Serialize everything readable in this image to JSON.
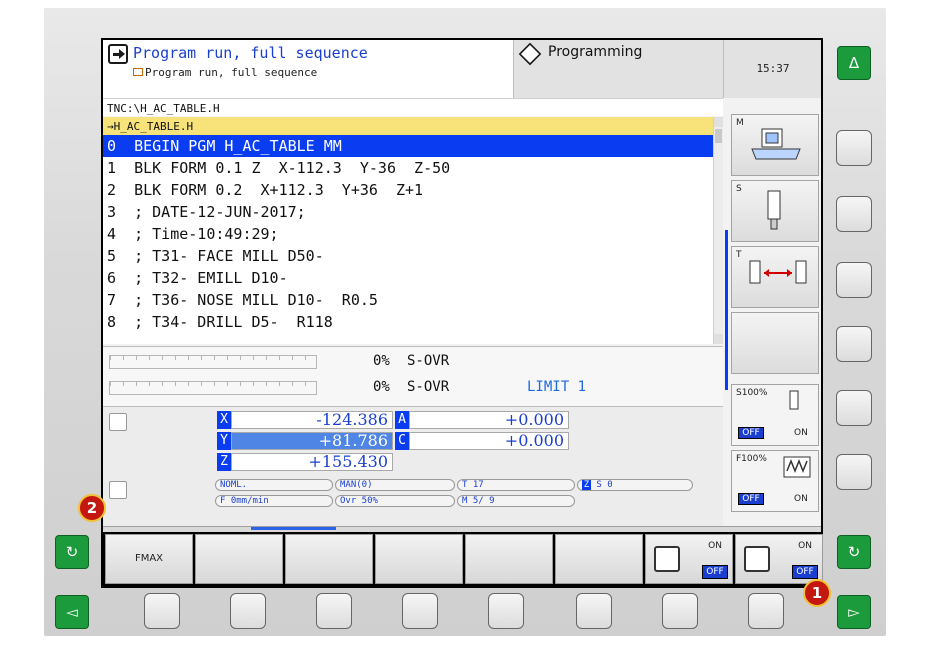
{
  "header": {
    "mode_title": "Program run, full sequence",
    "mode_subtitle": "Program run, full sequence",
    "secondary_mode": "Programming",
    "clock": "15:37"
  },
  "program": {
    "path": "TNC:\\H_AC_TABLE.H",
    "file": "→H_AC_TABLE.H",
    "lines": [
      "0  BEGIN PGM H_AC_TABLE MM",
      "1  BLK FORM 0.1 Z  X-112.3  Y-36  Z-50",
      "2  BLK FORM 0.2  X+112.3  Y+36  Z+1",
      "3  ; DATE-12-JUN-2017;",
      "4  ; Time-10:49:29;",
      "5  ; T31- FACE MILL D50-",
      "6  ; T32- EMILL D10-",
      "7  ; T36- NOSE MILL D10-  R0.5",
      "8  ; T34- DRILL D5-  R118"
    ]
  },
  "override": {
    "feed_pct": "0%",
    "feed_label": "S-OVR",
    "spindle_pct": "0%",
    "spindle_label": "S-OVR",
    "limit": "LIMIT 1"
  },
  "positions": {
    "x_label": "X",
    "x_value": "-124.386",
    "y_label": "Y",
    "y_value": "+81.786",
    "z_label": "Z",
    "z_value": "+155.430",
    "a_label": "A",
    "a_value": "+0.000",
    "c_label": "C",
    "c_value": "+0.000"
  },
  "status": {
    "noml": "NOML.",
    "man": "MAN(0)",
    "tool": "T 17",
    "z_axis": "Z",
    "spindle": "S    0",
    "feed": "F  0mm/min",
    "ovr": "Ovr  50%",
    "m_code": "M 5/ 9"
  },
  "right_softkeys": {
    "m_tag": "M",
    "s_tag": "S",
    "t_tag": "T",
    "s100": "S100%",
    "f100": "F100%",
    "off": "OFF",
    "on": "ON"
  },
  "softkeys": {
    "fmax": "FMAX",
    "on": "ON",
    "off": "OFF"
  },
  "hardware": {
    "up_arrow": "Δ",
    "left_arrow": "◅",
    "right_arrow": "▻",
    "circle_left": "↻",
    "circle_right": "↻"
  },
  "markers": {
    "one": "1",
    "two": "2"
  },
  "colors": {
    "accent_blue": "#0a3df2",
    "file_bar": "#f8e27a",
    "green_button": "#1c9b3c",
    "marker_red": "#c4170f"
  }
}
